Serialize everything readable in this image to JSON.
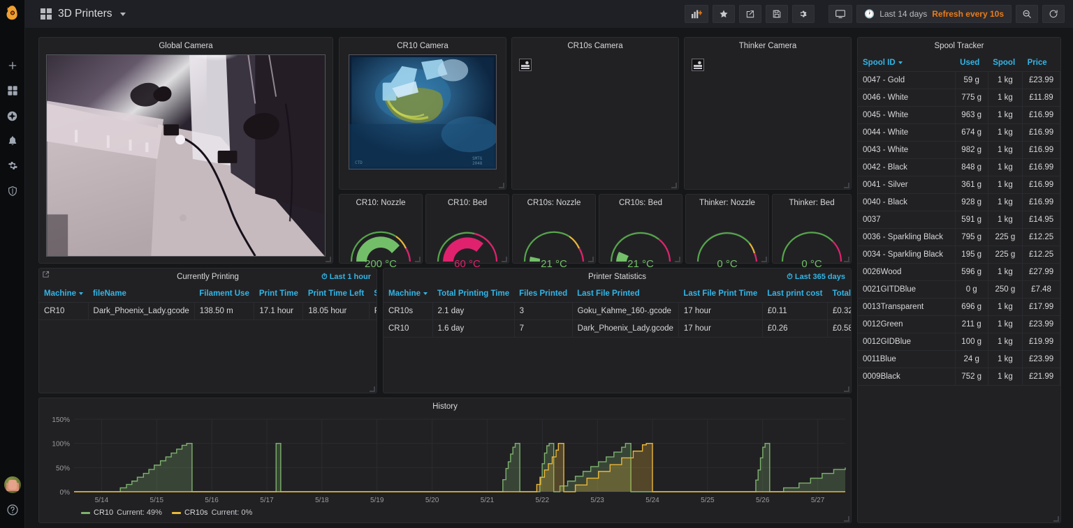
{
  "brand": {
    "logo": "grafana-logo"
  },
  "sidebar": {
    "items": [
      {
        "name": "create",
        "icon": "plus-icon"
      },
      {
        "name": "dashboards",
        "icon": "apps-grid-icon"
      },
      {
        "name": "explore",
        "icon": "compass-icon"
      },
      {
        "name": "alerting",
        "icon": "bell-icon"
      },
      {
        "name": "configuration",
        "icon": "gear-icon"
      },
      {
        "name": "server-admin",
        "icon": "shield-icon"
      }
    ],
    "bottom": [
      {
        "name": "user-avatar",
        "icon": "avatar-icon"
      },
      {
        "name": "help",
        "icon": "question-circle-icon"
      }
    ]
  },
  "topnav": {
    "dashboard_title": "3D Printers",
    "buttons": [
      {
        "name": "add-panel",
        "icon": "add-panel-icon"
      },
      {
        "name": "mark-favorite",
        "icon": "star-icon"
      },
      {
        "name": "share-dashboard",
        "icon": "share-icon"
      },
      {
        "name": "save-dashboard",
        "icon": "save-icon"
      },
      {
        "name": "dashboard-settings",
        "icon": "gear-icon"
      },
      {
        "name": "tv-mode",
        "icon": "monitor-icon"
      }
    ],
    "time_range": "Last 14 days",
    "refresh_interval": "Refresh every 10s",
    "zoom_out_label": "zoom-out-icon",
    "refresh_label": "refresh-icon",
    "accent_orange": "#eb7b18",
    "accent_blue": "#33b5e5"
  },
  "panels": {
    "global_camera": {
      "title": "Global Camera"
    },
    "cr10_camera": {
      "title": "CR10 Camera"
    },
    "cr10s_camera": {
      "title": "CR10s Camera",
      "state": "broken-image"
    },
    "thinker_camera": {
      "title": "Thinker Camera",
      "state": "broken-image"
    },
    "currently_printing": {
      "title": "Currently Printing",
      "time_range": "Last 1 hour"
    },
    "printer_statistics": {
      "title": "Printer Statistics",
      "time_range": "Last 365 days"
    },
    "history": {
      "title": "History"
    },
    "spool_tracker": {
      "title": "Spool Tracker"
    }
  },
  "gauges": [
    {
      "title": "CR10: Nozzle",
      "value": "200 °C",
      "pct": 0.8,
      "color": "#56a64b"
    },
    {
      "title": "CR10: Bed",
      "value": "60 °C",
      "pct": 0.72,
      "color": "#e0226e"
    },
    {
      "title": "CR10s: Nozzle",
      "value": "21 °C",
      "pct": 0.07,
      "color": "#56a64b"
    },
    {
      "title": "CR10s: Bed",
      "value": "21 °C",
      "pct": 0.1,
      "color": "#73bf69"
    },
    {
      "title": "Thinker: Nozzle",
      "value": "0 °C",
      "pct": 0.0,
      "color": "#73bf69"
    },
    {
      "title": "Thinker: Bed",
      "value": "0 °C",
      "pct": 0.0,
      "color": "#73bf69"
    }
  ],
  "currently_printing": {
    "columns": [
      "Machine",
      "fileName",
      "Filament Use",
      "Print Time",
      "Print Time Left",
      "Status"
    ],
    "sorted_column": "Machine",
    "rows": [
      [
        "CR10",
        "Dark_Phoenix_Lady.gcode",
        "138.50 m",
        "17.1 hour",
        "18.05 hour",
        "Printing"
      ]
    ]
  },
  "printer_statistics": {
    "columns": [
      "Machine",
      "Total Printing Time",
      "Files Printed",
      "Last File Printed",
      "Last File Print Time",
      "Last print cost",
      "Total Running Costs"
    ],
    "sorted_column": "Machine",
    "rows": [
      [
        "CR10s",
        "2.1 day",
        "3",
        "Goku_Kahme_160-.gcode",
        "17 hour",
        "£0.11",
        "£0.32"
      ],
      [
        "CR10",
        "1.6 day",
        "7",
        "Dark_Phoenix_Lady.gcode",
        "17 hour",
        "£0.26",
        "£0.58"
      ]
    ]
  },
  "spool_tracker": {
    "columns": [
      "Spool ID",
      "Used",
      "Spool",
      "Price"
    ],
    "sorted_column": "Spool ID",
    "rows": [
      {
        "id": "0047 - Gold",
        "used": "59 g",
        "used_color": "green",
        "spool": "1 kg",
        "price": "£23.99"
      },
      {
        "id": "0046 - White",
        "used": "775 g",
        "used_color": "orange",
        "spool": "1 kg",
        "price": "£11.89"
      },
      {
        "id": "0045 - White",
        "used": "963 g",
        "used_color": "red",
        "spool": "1 kg",
        "price": "£16.99"
      },
      {
        "id": "0044 - White",
        "used": "674 g",
        "used_color": "orange",
        "spool": "1 kg",
        "price": "£16.99"
      },
      {
        "id": "0043 - White",
        "used": "982 g",
        "used_color": "red",
        "spool": "1 kg",
        "price": "£16.99"
      },
      {
        "id": "0042 - Black",
        "used": "848 g",
        "used_color": "orange",
        "spool": "1 kg",
        "price": "£16.99"
      },
      {
        "id": "0041 - Silver",
        "used": "361 g",
        "used_color": "orange",
        "spool": "1 kg",
        "price": "£16.99"
      },
      {
        "id": "0040 - Black",
        "used": "928 g",
        "used_color": "orange",
        "spool": "1 kg",
        "price": "£16.99"
      },
      {
        "id": "0037",
        "used": "591 g",
        "used_color": "orange",
        "spool": "1 kg",
        "price": "£14.95"
      },
      {
        "id": "0036 - Sparkling Black",
        "used": "795 g",
        "used_color": "orange",
        "spool": "225 g",
        "price": "£12.25"
      },
      {
        "id": "0034 - Sparkling Black",
        "used": "195 g",
        "used_color": "green",
        "spool": "225 g",
        "price": "£12.25"
      },
      {
        "id": "0026Wood",
        "used": "596 g",
        "used_color": "orange",
        "spool": "1 kg",
        "price": "£27.99"
      },
      {
        "id": "0021GITDBlue",
        "used": "0 g",
        "used_color": "green",
        "spool": "250 g",
        "price": "£7.48"
      },
      {
        "id": "0013Transparent",
        "used": "696 g",
        "used_color": "orange",
        "spool": "1 kg",
        "price": "£17.99"
      },
      {
        "id": "0012Green",
        "used": "211 g",
        "used_color": "green",
        "spool": "1 kg",
        "price": "£23.99"
      },
      {
        "id": "0012GIDBlue",
        "used": "100 g",
        "used_color": "green",
        "spool": "1 kg",
        "price": "£19.99"
      },
      {
        "id": "0011Blue",
        "used": "24 g",
        "used_color": "green",
        "spool": "1 kg",
        "price": "£23.99"
      },
      {
        "id": "0009Black",
        "used": "752 g",
        "used_color": "orange",
        "spool": "1 kg",
        "price": "£21.99"
      }
    ]
  },
  "chart_data": {
    "type": "area",
    "title": "History",
    "xlabel": "",
    "ylabel": "",
    "ylim": [
      0,
      150
    ],
    "yticks": [
      "0%",
      "50%",
      "100%",
      "150%"
    ],
    "xticks": [
      "5/14",
      "5/15",
      "5/16",
      "5/17",
      "5/18",
      "5/19",
      "5/20",
      "5/21",
      "5/22",
      "5/23",
      "5/24",
      "5/25",
      "5/26",
      "5/27"
    ],
    "grid": true,
    "legend_position": "bottom-left",
    "series": [
      {
        "name": "CR10",
        "color": "#7eb26d",
        "stat_label": "Current:",
        "stat_value": "49%",
        "points": [
          [
            0.0,
            0
          ],
          [
            0.055,
            0
          ],
          [
            0.06,
            8
          ],
          [
            0.068,
            15
          ],
          [
            0.075,
            22
          ],
          [
            0.082,
            30
          ],
          [
            0.09,
            38
          ],
          [
            0.097,
            46
          ],
          [
            0.104,
            55
          ],
          [
            0.112,
            64
          ],
          [
            0.119,
            72
          ],
          [
            0.126,
            80
          ],
          [
            0.133,
            88
          ],
          [
            0.14,
            96
          ],
          [
            0.146,
            100
          ],
          [
            0.152,
            100
          ],
          [
            0.153,
            0
          ],
          [
            0.26,
            0
          ],
          [
            0.262,
            100
          ],
          [
            0.266,
            100
          ],
          [
            0.268,
            0
          ],
          [
            0.55,
            0
          ],
          [
            0.556,
            25
          ],
          [
            0.56,
            48
          ],
          [
            0.563,
            62
          ],
          [
            0.566,
            78
          ],
          [
            0.569,
            92
          ],
          [
            0.572,
            100
          ],
          [
            0.576,
            100
          ],
          [
            0.578,
            0
          ],
          [
            0.6,
            0
          ],
          [
            0.604,
            30
          ],
          [
            0.607,
            58
          ],
          [
            0.61,
            80
          ],
          [
            0.613,
            95
          ],
          [
            0.616,
            100
          ],
          [
            0.62,
            100
          ],
          [
            0.622,
            0
          ],
          [
            0.625,
            0
          ],
          [
            0.63,
            12
          ],
          [
            0.64,
            22
          ],
          [
            0.65,
            32
          ],
          [
            0.66,
            42
          ],
          [
            0.67,
            52
          ],
          [
            0.68,
            62
          ],
          [
            0.69,
            72
          ],
          [
            0.7,
            82
          ],
          [
            0.71,
            92
          ],
          [
            0.715,
            100
          ],
          [
            0.72,
            100
          ],
          [
            0.722,
            0
          ],
          [
            0.88,
            0
          ],
          [
            0.884,
            24
          ],
          [
            0.887,
            45
          ],
          [
            0.89,
            70
          ],
          [
            0.893,
            92
          ],
          [
            0.896,
            100
          ],
          [
            0.9,
            100
          ],
          [
            0.902,
            0
          ],
          [
            0.905,
            0
          ],
          [
            0.92,
            8
          ],
          [
            0.94,
            18
          ],
          [
            0.955,
            28
          ],
          [
            0.97,
            38
          ],
          [
            0.985,
            46
          ],
          [
            1.0,
            50
          ]
        ]
      },
      {
        "name": "CR10s",
        "color": "#eab839",
        "stat_label": "Current:",
        "stat_value": "0%",
        "points": [
          [
            0.0,
            0
          ],
          [
            0.595,
            0
          ],
          [
            0.6,
            15
          ],
          [
            0.605,
            30
          ],
          [
            0.61,
            45
          ],
          [
            0.615,
            58
          ],
          [
            0.62,
            72
          ],
          [
            0.625,
            86
          ],
          [
            0.628,
            100
          ],
          [
            0.632,
            100
          ],
          [
            0.635,
            0
          ],
          [
            0.638,
            0
          ],
          [
            0.65,
            14
          ],
          [
            0.665,
            28
          ],
          [
            0.68,
            42
          ],
          [
            0.695,
            56
          ],
          [
            0.71,
            70
          ],
          [
            0.725,
            84
          ],
          [
            0.737,
            97
          ],
          [
            0.742,
            100
          ],
          [
            0.748,
            100
          ],
          [
            0.75,
            0
          ],
          [
            1.0,
            0
          ]
        ]
      }
    ]
  }
}
